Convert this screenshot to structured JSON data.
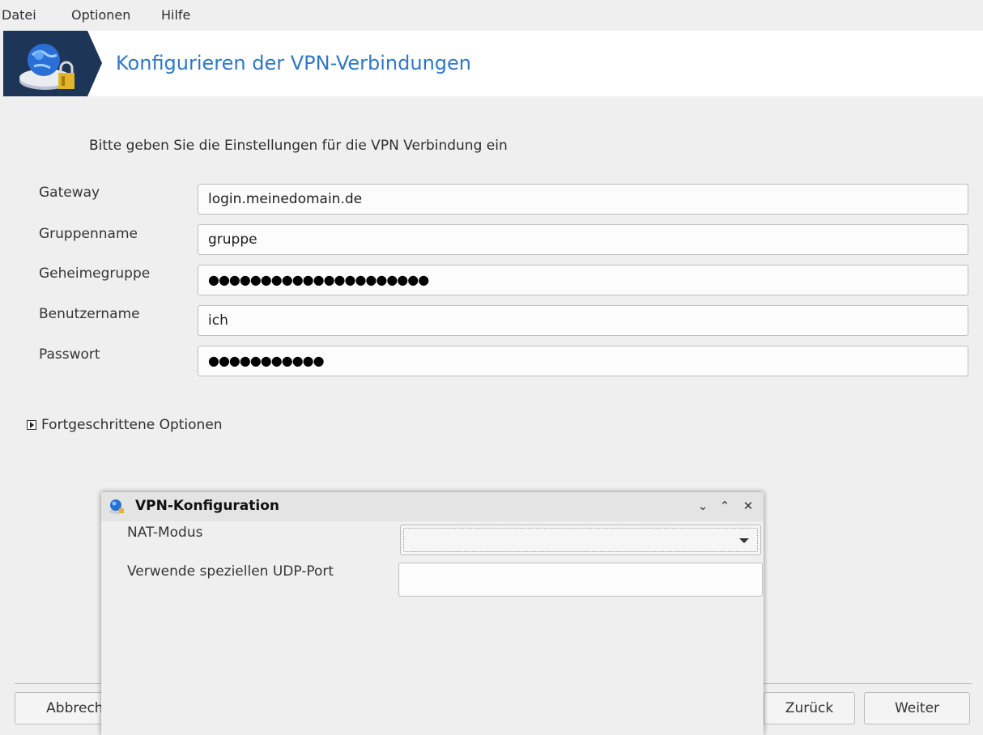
{
  "menu": {
    "items": [
      "Datei",
      "Optionen",
      "Hilfe"
    ]
  },
  "header": {
    "title": "Konfigurieren der VPN-Verbindungen"
  },
  "intro": "Bitte geben Sie die Einstellungen für die VPN Verbindung ein",
  "form": {
    "gateway": {
      "label": "Gateway",
      "value": "login.meinedomain.de"
    },
    "group": {
      "label": "Gruppenname",
      "value": "gruppe"
    },
    "group_secret": {
      "label": "Geheimegruppe",
      "masked": "●●●●●●●●●●●●●●●●●●●●●"
    },
    "username": {
      "label": "Benutzername",
      "value": "ich"
    },
    "password": {
      "label": "Passwort",
      "masked": "●●●●●●●●●●●"
    }
  },
  "advanced": {
    "label": "Fortgeschrittene Optionen"
  },
  "buttons": {
    "cancel": "Abbrechen",
    "back": "Zurück",
    "next": "Weiter"
  },
  "dialog": {
    "title": "VPN-Konfiguration",
    "nat_mode": {
      "label": "NAT-Modus",
      "value": ""
    },
    "udp_port": {
      "label": "Verwende speziellen UDP-Port",
      "value": ""
    },
    "controls": {
      "minimize": "⌄",
      "maximize": "⌃",
      "close": "✕"
    }
  },
  "colors": {
    "title": "#2f78c8",
    "background": "#efefef",
    "header_bg": "#ffffff",
    "logo_bg": "#1d3557"
  }
}
